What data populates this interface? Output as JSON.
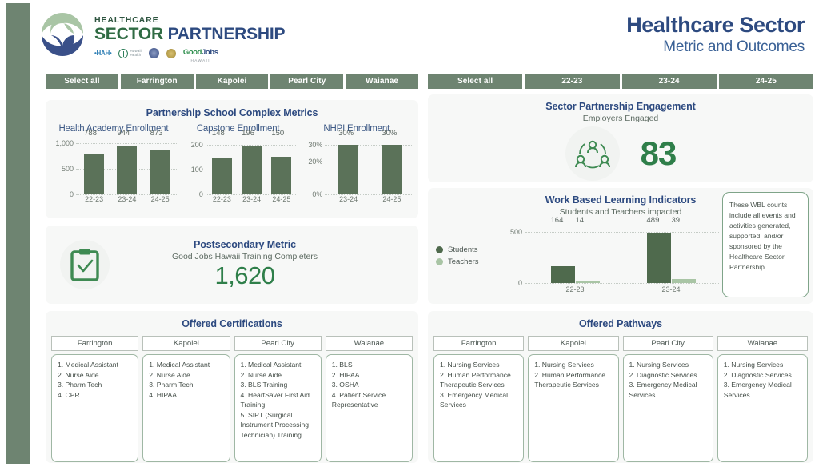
{
  "brand": {
    "line1": "HEALTHCARE",
    "line2_part1": "SECTOR ",
    "line2_part2": "PARTNERSHIP",
    "partners": [
      {
        "name": "hah-logo",
        "text": "HAH",
        "sub": ""
      },
      {
        "name": "healthcare-assoc-logo",
        "text": "H",
        "sub": "Hawaii Health"
      },
      {
        "name": "university-seal-logo",
        "text": "",
        "sub": ""
      },
      {
        "name": "gold-seal-logo",
        "text": "",
        "sub": ""
      },
      {
        "name": "good-jobs-hawaii-logo",
        "text": "Good",
        "text2": "Jobs",
        "sub": "HAWAII"
      }
    ]
  },
  "header": {
    "title": "Healthcare Sector",
    "subtitle": "Metric and Outcomes"
  },
  "filters": {
    "schools": [
      "Select all",
      "Farrington",
      "Kapolei",
      "Pearl City",
      "Waianae"
    ],
    "years": [
      "Select all",
      "22-23",
      "23-24",
      "24-25"
    ]
  },
  "school_metrics": {
    "title": "Partnership School Complex Metrics"
  },
  "postsecondary": {
    "title": "Postsecondary Metric",
    "subtitle": "Good Jobs Hawaii Training Completers",
    "value": "1,620",
    "icon": "clipboard-check-icon"
  },
  "engagement": {
    "title": "Sector Partnership Engagement",
    "subtitle": "Employers Engaged",
    "value": "83",
    "icon": "people-network-icon"
  },
  "wbl": {
    "title": "Work Based Learning Indicators",
    "subtitle": "Students and Teachers impacted",
    "note": "These WBL counts include all events and activities generated, supported, and/or sponsored by the Healthcare Sector Partnership."
  },
  "certifications": {
    "title": "Offered Certifications",
    "columns": [
      {
        "header": "Farrington",
        "items": [
          "1. Medical Assistant",
          "2. Nurse Aide",
          "3. Pharm Tech",
          "4. CPR"
        ]
      },
      {
        "header": "Kapolei",
        "items": [
          "1. Medical Assistant",
          "2. Nurse Aide",
          "3. Pharm Tech",
          "4. HIPAA"
        ]
      },
      {
        "header": "Pearl City",
        "items": [
          "1. Medical Assistant",
          "2. Nurse Aide",
          "3. BLS Training",
          "4. HeartSaver First Aid Training",
          "5. SIPT (Surgical Instrument Processing Technician) Training"
        ]
      },
      {
        "header": "Waianae",
        "items": [
          "1. BLS",
          "2. HIPAA",
          "3. OSHA",
          "4. Patient Service Representative"
        ]
      }
    ]
  },
  "pathways": {
    "title": "Offered Pathways",
    "columns": [
      {
        "header": "Farrington",
        "items": [
          "1. Nursing Services",
          "2. Human Performance Therapeutic Services",
          "3. Emergency Medical Services"
        ]
      },
      {
        "header": "Kapolei",
        "items": [
          "1. Nursing Services",
          "2. Human Performance Therapeutic Services"
        ]
      },
      {
        "header": "Pearl City",
        "items": [
          "1. Nursing Services",
          "2. Diagnostic Services",
          "3. Emergency Medical Services"
        ]
      },
      {
        "header": "Waianae",
        "items": [
          "1. Nursing Services",
          "2. Diagnostic Services",
          "3. Emergency Medical Services"
        ]
      }
    ]
  },
  "colors": {
    "sage": "#6e8471",
    "bar_green": "#5b7259",
    "bar_light_green": "#a9c5a5",
    "title_blue": "#2d4a80",
    "value_green": "#2f7f4a",
    "card_bg": "#f7f8f7"
  },
  "chart_data": [
    {
      "type": "bar",
      "title": "Health Academy Enrollment",
      "categories": [
        "22-23",
        "23-24",
        "24-25"
      ],
      "values": [
        788,
        944,
        873
      ],
      "value_labels": [
        "788",
        "944",
        "873"
      ],
      "yticks": [
        "1,000",
        "500",
        "0"
      ],
      "ytick_values": [
        1000,
        500,
        0
      ],
      "ylim": [
        0,
        1100
      ],
      "xlabel": "",
      "ylabel": "",
      "grid": true,
      "legend": "none"
    },
    {
      "type": "bar",
      "title": "Capstone Enrollment",
      "categories": [
        "22-23",
        "23-24",
        "24-25"
      ],
      "values": [
        148,
        196,
        150
      ],
      "value_labels": [
        "148",
        "196",
        "150"
      ],
      "yticks": [
        "200",
        "100",
        "0"
      ],
      "ytick_values": [
        200,
        100,
        0
      ],
      "ylim": [
        0,
        225
      ],
      "xlabel": "",
      "ylabel": "",
      "grid": true,
      "legend": "none"
    },
    {
      "type": "bar",
      "title": "NHPI Enrollment",
      "categories": [
        "23-24",
        "24-25"
      ],
      "values": [
        30,
        30
      ],
      "value_labels": [
        "30%",
        "30%"
      ],
      "yticks": [
        "30%",
        "20%",
        "0%"
      ],
      "ytick_values": [
        30,
        20,
        0
      ],
      "ylim": [
        0,
        34
      ],
      "xlabel": "",
      "ylabel": "",
      "grid": true,
      "legend": "none"
    },
    {
      "type": "bar",
      "title": "Work Based Learning Indicators",
      "subtitle": "Students and Teachers impacted",
      "categories": [
        "22-23",
        "23-24"
      ],
      "series": [
        {
          "name": "Students",
          "values": [
            164,
            489
          ],
          "color": "#4f6a4d"
        },
        {
          "name": "Teachers",
          "values": [
            14,
            39
          ],
          "color": "#a9c5a5"
        }
      ],
      "value_labels": [
        [
          "164",
          "14"
        ],
        [
          "489",
          "39"
        ]
      ],
      "yticks": [
        "500",
        "0"
      ],
      "ytick_values": [
        500,
        0
      ],
      "ylim": [
        0,
        560
      ],
      "xlabel": "",
      "ylabel": "",
      "grid": true,
      "legend": "left"
    }
  ]
}
